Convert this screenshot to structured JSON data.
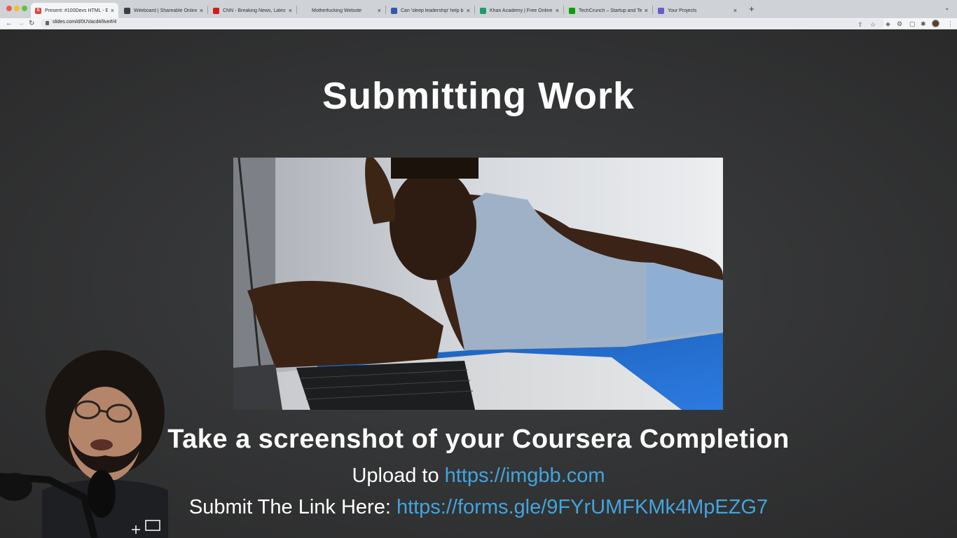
{
  "browser": {
    "tabs": [
      {
        "title": "Present: #100Devs HTML - Eve",
        "favicon_color": "#e0463d",
        "favicon_glyph": "S",
        "active": true
      },
      {
        "title": "Witeboard | Shareable Online",
        "favicon_color": "#3b3f45",
        "favicon_glyph": "",
        "active": false
      },
      {
        "title": "CNN - Breaking News, Latest N",
        "favicon_color": "#cc1e1e",
        "favicon_glyph": "",
        "active": false
      },
      {
        "title": "Motherfucking Website",
        "favicon_color": "",
        "favicon_glyph": "",
        "active": false
      },
      {
        "title": "Can 'sleep leadership' help bo",
        "favicon_color": "#2e5aa8",
        "favicon_glyph": "",
        "active": false
      },
      {
        "title": "Khan Academy | Free Online C",
        "favicon_color": "#1d9a6c",
        "favicon_glyph": "",
        "active": false
      },
      {
        "title": "TechCrunch – Startup and Tec",
        "favicon_color": "#0a9e01",
        "favicon_glyph": "",
        "active": false
      },
      {
        "title": "Your Projects",
        "favicon_color": "#6a5acd",
        "favicon_glyph": "",
        "active": false
      }
    ],
    "url": "slides.com/d/0UVacd4/live#/4",
    "new_tab_icon": "plus-icon",
    "tab_menu_icon": "chevron-down-icon"
  },
  "slide": {
    "title": "Submitting Work",
    "caption": "Take a screenshot of your Coursera Completion",
    "upload_label": "Upload to ",
    "upload_link": "https://imgbb.com",
    "submit_label": "Submit The Link Here: ",
    "submit_link": "https://forms.gle/9FYrUMFKMk4MpEZG7",
    "link_color": "#42a5dc"
  }
}
